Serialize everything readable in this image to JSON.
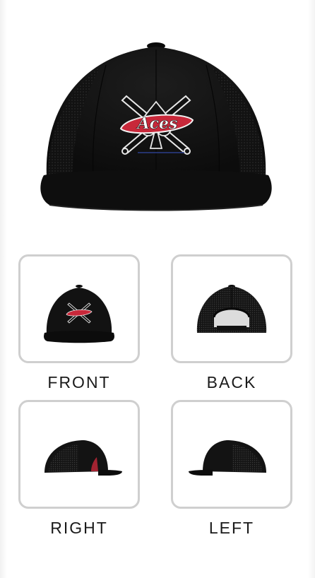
{
  "hero": {
    "logo_text": "Aces"
  },
  "views": [
    {
      "label": "FRONT",
      "icon": "cap-front-icon"
    },
    {
      "label": "BACK",
      "icon": "cap-back-icon"
    },
    {
      "label": "RIGHT",
      "icon": "cap-right-icon"
    },
    {
      "label": "LEFT",
      "icon": "cap-left-icon"
    }
  ],
  "colors": {
    "cap": "#141414",
    "logo_red": "#c8283a",
    "border": "#cfcfcf"
  }
}
